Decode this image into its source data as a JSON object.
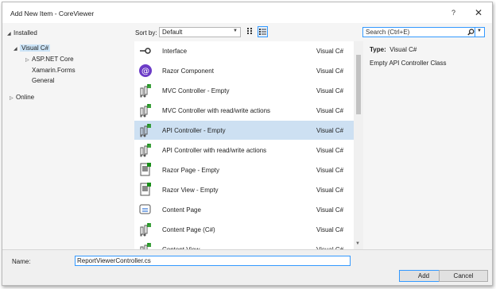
{
  "window": {
    "title": "Add New Item - CoreViewer",
    "help": "?",
    "close": "✕"
  },
  "tree": {
    "installed": "Installed",
    "visual_csharp": "Visual C#",
    "aspnet_core": "ASP.NET Core",
    "xamarin_forms": "Xamarin.Forms",
    "general": "General",
    "online": "Online"
  },
  "toolbar": {
    "sort_label": "Sort by:",
    "sort_value": "Default"
  },
  "search": {
    "placeholder": "Search (Ctrl+E)"
  },
  "templates": [
    {
      "name": "Interface",
      "lang": "Visual C#",
      "icon": "interface-icon"
    },
    {
      "name": "Razor Component",
      "lang": "Visual C#",
      "icon": "razor-component-icon"
    },
    {
      "name": "MVC Controller - Empty",
      "lang": "Visual C#",
      "icon": "controller-icon"
    },
    {
      "name": "MVC Controller with read/write actions",
      "lang": "Visual C#",
      "icon": "controller-icon"
    },
    {
      "name": "API Controller - Empty",
      "lang": "Visual C#",
      "icon": "controller-icon",
      "selected": true
    },
    {
      "name": "API Controller with read/write actions",
      "lang": "Visual C#",
      "icon": "controller-icon"
    },
    {
      "name": "Razor Page - Empty",
      "lang": "Visual C#",
      "icon": "razor-page-icon"
    },
    {
      "name": "Razor View - Empty",
      "lang": "Visual C#",
      "icon": "razor-view-icon"
    },
    {
      "name": "Content Page",
      "lang": "Visual C#",
      "icon": "content-page-icon"
    },
    {
      "name": "Content Page (C#)",
      "lang": "Visual C#",
      "icon": "content-page-csharp-icon"
    },
    {
      "name": "Content View",
      "lang": "Visual C#",
      "icon": "content-view-icon"
    }
  ],
  "details": {
    "type_label": "Type:",
    "type_value": "Visual C#",
    "description": "Empty API Controller Class"
  },
  "footer": {
    "name_label": "Name:",
    "name_value": "ReportViewerController.cs",
    "add_label": "Add",
    "cancel_label": "Cancel"
  },
  "colors": {
    "selection": "#cde0f2",
    "accent": "#3399ff",
    "icon_green": "#1a8f1a",
    "icon_purple": "#6c3cc7"
  }
}
